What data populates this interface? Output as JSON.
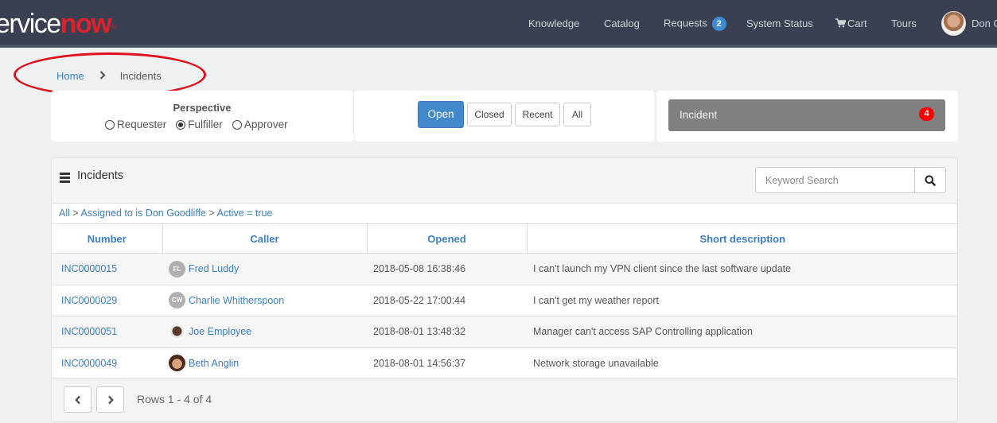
{
  "header": {
    "logo_part1": "ervice",
    "logo_part2": "now",
    "logo_mark": "®",
    "nav": [
      {
        "label": "Knowledge"
      },
      {
        "label": "Catalog"
      },
      {
        "label": "Requests",
        "badge": "2"
      },
      {
        "label": "System Status"
      },
      {
        "label": "Cart",
        "icon": "cart-icon"
      },
      {
        "label": "Tours"
      }
    ],
    "user_name": "Don G",
    "accent_color": "#d9232d",
    "badge_color": "#3f8bd0"
  },
  "breadcrumb": {
    "home": "Home",
    "separator_icon": "chevron-right-icon",
    "current": "Incidents"
  },
  "perspective": {
    "title": "Perspective",
    "options": [
      {
        "label": "Requester",
        "selected": false
      },
      {
        "label": "Fulfiller",
        "selected": true
      },
      {
        "label": "Approver",
        "selected": false
      }
    ]
  },
  "state_filter": {
    "buttons": [
      {
        "label": "Open",
        "active": true
      },
      {
        "label": "Closed",
        "active": false
      },
      {
        "label": "Recent",
        "active": false
      },
      {
        "label": "All",
        "active": false
      }
    ],
    "active_color": "#4189cb"
  },
  "count_tile": {
    "label": "Incident",
    "count": "4",
    "badge_color": "#ff0000"
  },
  "panel": {
    "title": "Incidents",
    "search_placeholder": "Keyword Search",
    "search_value": "",
    "filter": {
      "all": "All",
      "sep": ">",
      "cond1": "Assigned to is Don Goodliffe",
      "cond2": "Active = true"
    },
    "columns": [
      "Number",
      "Caller",
      "Opened",
      "Short description"
    ],
    "rows": [
      {
        "number": "INC0000015",
        "caller": "Fred Luddy",
        "initials": "FL",
        "avatar": "initials",
        "opened": "2018-05-08 16:38:46",
        "description": "I can't launch my VPN client since the last software update"
      },
      {
        "number": "INC0000029",
        "caller": "Charlie Whitherspoon",
        "initials": "CW",
        "avatar": "initials",
        "opened": "2018-05-22 17:00:44",
        "description": "I can't get my weather report"
      },
      {
        "number": "INC0000051",
        "caller": "Joe Employee",
        "initials": "",
        "avatar": "photo-joe",
        "opened": "2018-08-01 13:48:32",
        "description": "Manager can't access SAP Controlling application"
      },
      {
        "number": "INC0000049",
        "caller": "Beth Anglin",
        "initials": "",
        "avatar": "photo-beth",
        "opened": "2018-08-01 14:56:37",
        "description": "Network storage unavailable"
      }
    ],
    "pagination": {
      "label": "Rows 1 - 4 of 4"
    }
  }
}
